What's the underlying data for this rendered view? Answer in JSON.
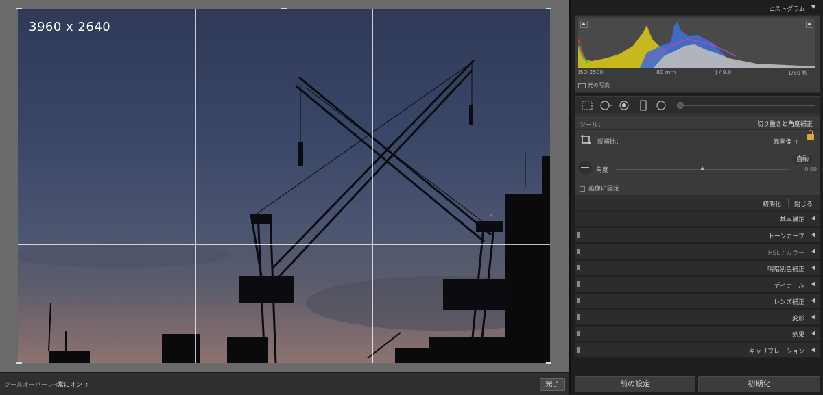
{
  "photo": {
    "dimensions": "3960 x 2640"
  },
  "bottom_bar": {
    "overlay_label": "ツールオーバーレイ：",
    "overlay_value": "常にオン ÷",
    "done_label": "完了"
  },
  "histogram": {
    "title": "ヒストグラム",
    "iso": "ISO 2500",
    "focal": "80 mm",
    "aperture": "ƒ / 9.0",
    "shutter": "1/80 秒",
    "original_photo": "元の写真"
  },
  "crop": {
    "tool_label": "ツール：",
    "tool_name": "切り抜きと角度補正",
    "aspect_label": "縦横比：",
    "aspect_value": "元画像 ÷",
    "auto_label": "自動",
    "angle_label": "角度",
    "angle_value": "0.00",
    "constrain_label": "画像に固定",
    "reset_label": "初期化",
    "close_label": "閉じる"
  },
  "sections": [
    {
      "label": "基本補正"
    },
    {
      "label": "トーンカーブ"
    },
    {
      "label": "HSL / カラー"
    },
    {
      "label": "明暗別色補正"
    },
    {
      "label": "ディテール"
    },
    {
      "label": "レンズ補正"
    },
    {
      "label": "変形"
    },
    {
      "label": "効果"
    },
    {
      "label": "キャリブレーション"
    }
  ],
  "footer": {
    "previous_label": "前の設定",
    "reset_label": "初期化"
  },
  "colors": {
    "accent_lock": "#d9a640",
    "panel_bg": "#1e1e1e"
  }
}
